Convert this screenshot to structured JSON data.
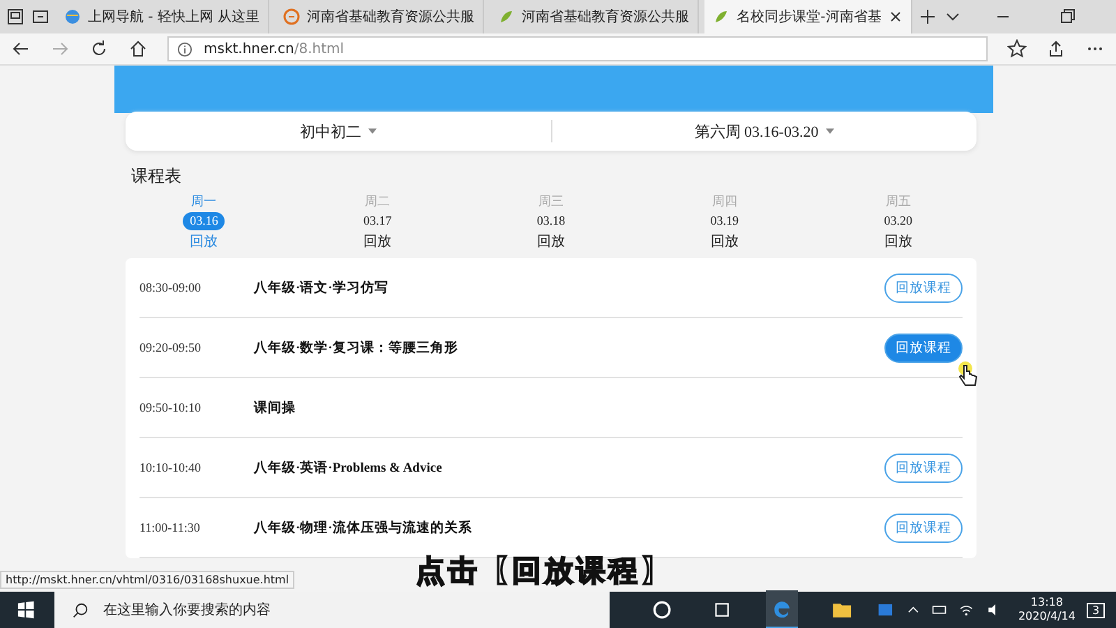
{
  "browser": {
    "tabs": [
      {
        "label": "上网导航 - 轻快上网 从这里",
        "selected": false,
        "kind": "globe"
      },
      {
        "label": "河南省基础教育资源公共服",
        "selected": false,
        "kind": "orange"
      },
      {
        "label": "河南省基础教育资源公共服",
        "selected": false,
        "kind": "leaf"
      },
      {
        "label": "名校同步课堂-河南省基",
        "selected": true,
        "kind": "leaf"
      }
    ],
    "address": {
      "host": "mskt.hner.cn",
      "path": "/8.html"
    }
  },
  "filters": {
    "grade": "初中初二",
    "week": "第六周 03.16-03.20"
  },
  "schedule_title": "课程表",
  "days": [
    {
      "weekday": "周一",
      "date": "03.16",
      "replay": "回放",
      "selected": true
    },
    {
      "weekday": "周二",
      "date": "03.17",
      "replay": "回放",
      "selected": false
    },
    {
      "weekday": "周三",
      "date": "03.18",
      "replay": "回放",
      "selected": false
    },
    {
      "weekday": "周四",
      "date": "03.19",
      "replay": "回放",
      "selected": false
    },
    {
      "weekday": "周五",
      "date": "03.20",
      "replay": "回放",
      "selected": false
    }
  ],
  "lessons": [
    {
      "kind": "course",
      "time": "08:30-09:00",
      "title": "八年级·语文·学习仿写",
      "button": "回放课程",
      "selected": false
    },
    {
      "kind": "course",
      "time": "09:20-09:50",
      "title": "八年级·数学·复习课：等腰三角形",
      "button": "回放课程",
      "selected": true
    },
    {
      "kind": "break",
      "time": "09:50-10:10",
      "title": "课间操"
    },
    {
      "kind": "course",
      "time": "10:10-10:40",
      "title": "八年级·英语·Problems & Advice",
      "button": "回放课程",
      "selected": false
    },
    {
      "kind": "course",
      "time": "11:00-11:30",
      "title": "八年级·物理·流体压强与流速的关系",
      "button": "回放课程",
      "selected": false
    }
  ],
  "status_url": "http://mskt.hner.cn/vhtml/0316/03168shuxue.html",
  "caption": "点击【回放课程】",
  "taskbar": {
    "search_placeholder": "在这里输入你要搜索的内容",
    "time": "13:18",
    "date": "2020/4/14",
    "notifications": "3"
  }
}
